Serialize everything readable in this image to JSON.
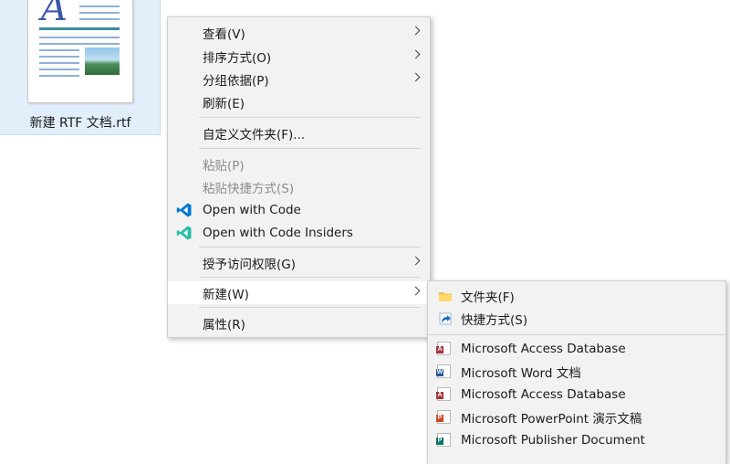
{
  "desktop": {
    "file_name": "新建 RTF 文档.rtf",
    "file_icon_letter": "A"
  },
  "context_menu": {
    "view": "查看(V)",
    "sort_by": "排序方式(O)",
    "group_by": "分组依据(P)",
    "refresh": "刷新(E)",
    "customize_folder": "自定义文件夹(F)...",
    "paste": "粘贴(P)",
    "paste_shortcut": "粘贴快捷方式(S)",
    "open_with_code": "Open with Code",
    "open_with_code_insiders": "Open with Code Insiders",
    "give_access": "授予访问权限(G)",
    "new": "新建(W)",
    "properties": "属性(R)"
  },
  "new_submenu": {
    "folder": "文件夹(F)",
    "shortcut": "快捷方式(S)",
    "items": [
      {
        "label": "Microsoft Access Database",
        "badge": "A",
        "color": "#a4373a"
      },
      {
        "label": "Microsoft Word 文档",
        "badge": "W",
        "color": "#2b579a"
      },
      {
        "label": "Microsoft Access Database",
        "badge": "A",
        "color": "#a4373a"
      },
      {
        "label": "Microsoft PowerPoint 演示文稿",
        "badge": "P",
        "color": "#d24726"
      },
      {
        "label": "Microsoft Publisher Document",
        "badge": "P",
        "color": "#077568"
      }
    ]
  },
  "colors": {
    "vscode_blue": "#0078d4",
    "vscode_insiders_green": "#24bfa5",
    "folder_yellow": "#f3c14b",
    "shortcut_arrow": "#1f6fc4",
    "desktop_selection": "#e3eefb"
  }
}
